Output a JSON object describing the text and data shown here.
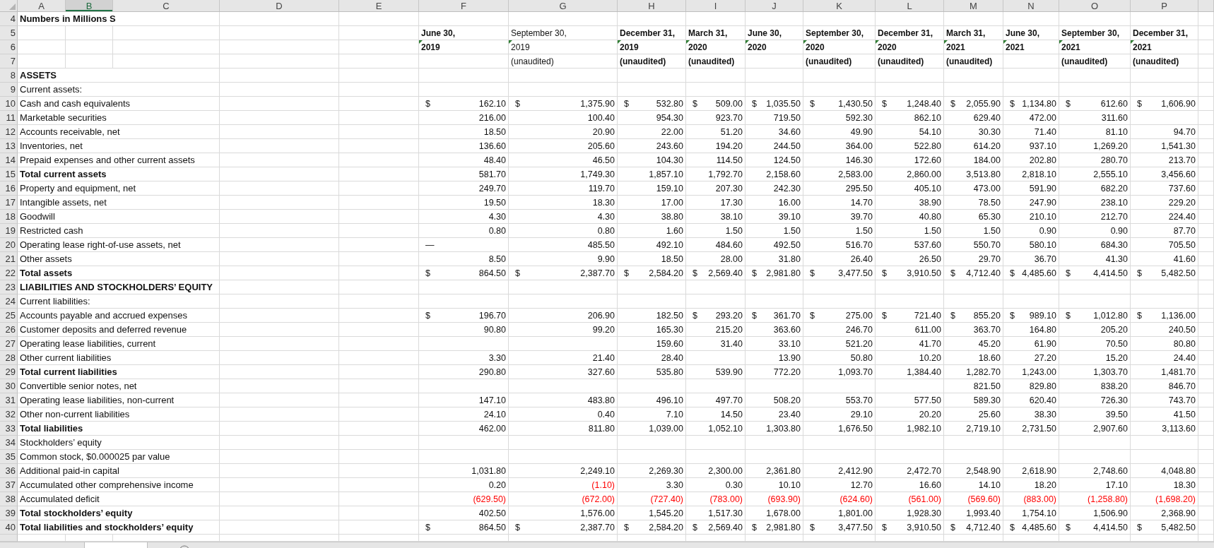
{
  "columns": [
    {
      "label": "A",
      "selected": false
    },
    {
      "label": "B",
      "selected": true
    },
    {
      "label": "C",
      "selected": false
    },
    {
      "label": "D",
      "selected": false
    },
    {
      "label": "E",
      "selected": false
    },
    {
      "label": "F",
      "selected": false
    },
    {
      "label": "G",
      "selected": false
    },
    {
      "label": "H",
      "selected": false
    },
    {
      "label": "I",
      "selected": false
    },
    {
      "label": "J",
      "selected": false
    },
    {
      "label": "K",
      "selected": false
    },
    {
      "label": "L",
      "selected": false
    },
    {
      "label": "M",
      "selected": false
    },
    {
      "label": "N",
      "selected": false
    },
    {
      "label": "O",
      "selected": false
    },
    {
      "label": "P",
      "selected": false
    }
  ],
  "title_row": {
    "number": "4",
    "text": "Numbers in Millions S"
  },
  "header_row_numbers": [
    "5",
    "6",
    "7"
  ],
  "periods": [
    {
      "date": "June 30,",
      "year": "2019",
      "bold": true
    },
    {
      "date": "September 30,",
      "year": "2019",
      "note": "(unaudited)",
      "bold": false
    },
    {
      "date": "December 31,",
      "year": "2019",
      "note": "(unaudited)",
      "bold": true
    },
    {
      "date": "March 31,",
      "year": "2020",
      "note": "(unaudited)",
      "bold": true
    },
    {
      "date": "June 30,",
      "year": "2020",
      "bold": true
    },
    {
      "date": "September 30,",
      "year": "2020",
      "note": "(unaudited)",
      "bold": true
    },
    {
      "date": "December 31,",
      "year": "2020",
      "note": "(unaudited)",
      "bold": true
    },
    {
      "date": "March 31,",
      "year": "2021",
      "note": "(unaudited)",
      "bold": true
    },
    {
      "date": "June 30,",
      "year": "2021",
      "bold": true
    },
    {
      "date": "September 30,",
      "year": "2021",
      "note": "(unaudited)",
      "bold": true
    },
    {
      "date": "December 31,",
      "year": "2021",
      "note": "(unaudited)",
      "bold": true
    }
  ],
  "rows": [
    {
      "number": "8",
      "label": "ASSETS",
      "bold": true
    },
    {
      "number": "9",
      "label": "Current assets:",
      "bold": false
    },
    {
      "number": "10",
      "label": "Cash and cash equivalents",
      "bold": false,
      "cells": [
        {
          "symbol": "$",
          "value": "162.10"
        },
        {
          "symbol": "$",
          "value": "1,375.90"
        },
        {
          "symbol": "$",
          "value": "532.80"
        },
        {
          "symbol": "$",
          "value": "509.00"
        },
        {
          "symbol": "$",
          "value": "1,035.50"
        },
        {
          "symbol": "$",
          "value": "1,430.50"
        },
        {
          "symbol": "$",
          "value": "1,248.40"
        },
        {
          "symbol": "$",
          "value": "2,055.90"
        },
        {
          "symbol": "$",
          "value": "1,134.80"
        },
        {
          "symbol": "$",
          "value": "612.60"
        },
        {
          "symbol": "$",
          "value": "1,606.90"
        }
      ]
    },
    {
      "number": "11",
      "label": "Marketable securities",
      "bold": false,
      "cells": [
        "216.00",
        "100.40",
        "954.30",
        "923.70",
        "719.50",
        "592.30",
        "862.10",
        "629.40",
        "472.00",
        "311.60",
        null
      ]
    },
    {
      "number": "12",
      "label": "Accounts receivable, net",
      "bold": false,
      "cells": [
        "18.50",
        "20.90",
        "22.00",
        "51.20",
        "34.60",
        "49.90",
        "54.10",
        "30.30",
        "71.40",
        "81.10",
        "94.70"
      ]
    },
    {
      "number": "13",
      "label": "Inventories, net",
      "bold": false,
      "cells": [
        "136.60",
        "205.60",
        "243.60",
        "194.20",
        "244.50",
        "364.00",
        "522.80",
        "614.20",
        "937.10",
        "1,269.20",
        "1,541.30"
      ]
    },
    {
      "number": "14",
      "label": "Prepaid expenses and other current assets",
      "bold": false,
      "cells": [
        "48.40",
        "46.50",
        "104.30",
        "114.50",
        "124.50",
        "146.30",
        "172.60",
        "184.00",
        "202.80",
        "280.70",
        "213.70"
      ]
    },
    {
      "number": "15",
      "label": "Total current assets",
      "bold": true,
      "cells": [
        "581.70",
        "1,749.30",
        "1,857.10",
        "1,792.70",
        "2,158.60",
        "2,583.00",
        "2,860.00",
        "3,513.80",
        "2,818.10",
        "2,555.10",
        "3,456.60"
      ]
    },
    {
      "number": "16",
      "label": "Property and equipment, net",
      "bold": false,
      "cells": [
        "249.70",
        "119.70",
        "159.10",
        "207.30",
        "242.30",
        "295.50",
        "405.10",
        "473.00",
        "591.90",
        "682.20",
        "737.60"
      ]
    },
    {
      "number": "17",
      "label": "Intangible assets, net",
      "bold": false,
      "cells": [
        "19.50",
        "18.30",
        "17.00",
        "17.30",
        "16.00",
        "14.70",
        "38.90",
        "78.50",
        "247.90",
        "238.10",
        "229.20"
      ]
    },
    {
      "number": "18",
      "label": "Goodwill",
      "bold": false,
      "cells": [
        "4.30",
        "4.30",
        "38.80",
        "38.10",
        "39.10",
        "39.70",
        "40.80",
        "65.30",
        "210.10",
        "212.70",
        "224.40"
      ]
    },
    {
      "number": "19",
      "label": "Restricted cash",
      "bold": false,
      "cells": [
        "0.80",
        "0.80",
        "1.60",
        "1.50",
        "1.50",
        "1.50",
        "1.50",
        "1.50",
        "0.90",
        "0.90",
        "87.70"
      ]
    },
    {
      "number": "20",
      "label": "Operating lease right-of-use assets, net",
      "bold": false,
      "cells": [
        {
          "symbol": "—"
        },
        "485.50",
        "492.10",
        "484.60",
        "492.50",
        "516.70",
        "537.60",
        "550.70",
        "580.10",
        "684.30",
        "705.50"
      ]
    },
    {
      "number": "21",
      "label": "Other assets",
      "bold": false,
      "cells": [
        "8.50",
        "9.90",
        "18.50",
        "28.00",
        "31.80",
        "26.40",
        "26.50",
        "29.70",
        "36.70",
        "41.30",
        "41.60"
      ]
    },
    {
      "number": "22",
      "label": "Total assets",
      "bold": true,
      "cells": [
        {
          "symbol": "$",
          "value": "864.50"
        },
        {
          "symbol": "$",
          "value": "2,387.70"
        },
        {
          "symbol": "$",
          "value": "2,584.20"
        },
        {
          "symbol": "$",
          "value": "2,569.40"
        },
        {
          "symbol": "$",
          "value": "2,981.80"
        },
        {
          "symbol": "$",
          "value": "3,477.50"
        },
        {
          "symbol": "$",
          "value": "3,910.50"
        },
        {
          "symbol": "$",
          "value": "4,712.40"
        },
        {
          "symbol": "$",
          "value": "4,485.60"
        },
        {
          "symbol": "$",
          "value": "4,414.50"
        },
        {
          "symbol": "$",
          "value": "5,482.50"
        }
      ]
    },
    {
      "number": "23",
      "label": "LIABILITIES AND STOCKHOLDERS’ EQUITY",
      "bold": true
    },
    {
      "number": "24",
      "label": "Current liabilities:",
      "bold": false
    },
    {
      "number": "25",
      "label": "Accounts payable and accrued expenses",
      "bold": false,
      "cells": [
        {
          "symbol": "$",
          "value": "196.70"
        },
        "206.90",
        "182.50",
        {
          "symbol": "$",
          "value": "293.20"
        },
        {
          "symbol": "$",
          "value": "361.70"
        },
        {
          "symbol": "$",
          "value": "275.00"
        },
        {
          "symbol": "$",
          "value": "721.40"
        },
        {
          "symbol": "$",
          "value": "855.20"
        },
        {
          "symbol": "$",
          "value": "989.10"
        },
        {
          "symbol": "$",
          "value": "1,012.80"
        },
        {
          "symbol": "$",
          "value": "1,136.00"
        }
      ]
    },
    {
      "number": "26",
      "label": "Customer deposits and deferred revenue",
      "bold": false,
      "cells": [
        "90.80",
        "99.20",
        "165.30",
        "215.20",
        "363.60",
        "246.70",
        "611.00",
        "363.70",
        "164.80",
        "205.20",
        "240.50"
      ]
    },
    {
      "number": "27",
      "label": "Operating lease liabilities, current",
      "bold": false,
      "cells": [
        null,
        null,
        "159.60",
        "31.40",
        "33.10",
        "521.20",
        "41.70",
        "45.20",
        "61.90",
        "70.50",
        "80.80"
      ]
    },
    {
      "number": "28",
      "label": "Other current liabilities",
      "bold": false,
      "cells": [
        "3.30",
        "21.40",
        "28.40",
        null,
        "13.90",
        "50.80",
        "10.20",
        "18.60",
        "27.20",
        "15.20",
        "24.40"
      ]
    },
    {
      "number": "29",
      "label": "Total current liabilities",
      "bold": true,
      "cells": [
        "290.80",
        "327.60",
        "535.80",
        "539.90",
        "772.20",
        "1,093.70",
        "1,384.40",
        "1,282.70",
        "1,243.00",
        "1,303.70",
        "1,481.70"
      ]
    },
    {
      "number": "30",
      "label": "Convertible senior notes, net",
      "bold": false,
      "cells": [
        null,
        null,
        null,
        null,
        null,
        null,
        null,
        "821.50",
        "829.80",
        "838.20",
        "846.70"
      ]
    },
    {
      "number": "31",
      "label": "Operating lease liabilities, non-current",
      "bold": false,
      "cells": [
        "147.10",
        "483.80",
        "496.10",
        "497.70",
        "508.20",
        "553.70",
        "577.50",
        "589.30",
        "620.40",
        "726.30",
        "743.70"
      ]
    },
    {
      "number": "32",
      "label": "Other non-current liabilities",
      "bold": false,
      "cells": [
        "24.10",
        "0.40",
        "7.10",
        "14.50",
        "23.40",
        "29.10",
        "20.20",
        "25.60",
        "38.30",
        "39.50",
        "41.50"
      ]
    },
    {
      "number": "33",
      "label": "Total liabilities",
      "bold": true,
      "cells": [
        "462.00",
        "811.80",
        "1,039.00",
        "1,052.10",
        "1,303.80",
        "1,676.50",
        "1,982.10",
        "2,719.10",
        "2,731.50",
        "2,907.60",
        "3,113.60"
      ]
    },
    {
      "number": "34",
      "label": "Stockholders’ equity",
      "bold": false
    },
    {
      "number": "35",
      "label": "Common stock, $0.000025 par value",
      "bold": false
    },
    {
      "number": "36",
      "label": "Additional paid-in capital",
      "bold": false,
      "cells": [
        "1,031.80",
        "2,249.10",
        "2,269.30",
        "2,300.00",
        "2,361.80",
        "2,412.90",
        "2,472.70",
        "2,548.90",
        "2,618.90",
        "2,748.60",
        "4,048.80"
      ]
    },
    {
      "number": "37",
      "label": "Accumulated other comprehensive income",
      "bold": false,
      "cells": [
        "0.20",
        {
          "value": "(1.10)",
          "negative": true
        },
        "3.30",
        "0.30",
        "10.10",
        "12.70",
        "16.60",
        "14.10",
        "18.20",
        "17.10",
        "18.30"
      ]
    },
    {
      "number": "38",
      "label": "Accumulated deficit",
      "bold": false,
      "cells": [
        {
          "value": "(629.50)",
          "negative": true
        },
        {
          "value": "(672.00)",
          "negative": true
        },
        {
          "value": "(727.40)",
          "negative": true
        },
        {
          "value": "(783.00)",
          "negative": true
        },
        {
          "value": "(693.90)",
          "negative": true
        },
        {
          "value": "(624.60)",
          "negative": true
        },
        {
          "value": "(561.00)",
          "negative": true
        },
        {
          "value": "(569.60)",
          "negative": true
        },
        {
          "value": "(883.00)",
          "negative": true
        },
        {
          "value": "(1,258.80)",
          "negative": true
        },
        {
          "value": "(1,698.20)",
          "negative": true
        }
      ]
    },
    {
      "number": "39",
      "label": "Total stockholders’ equity",
      "bold": true,
      "cells": [
        "402.50",
        "1,576.00",
        "1,545.20",
        "1,517.30",
        "1,678.00",
        "1,801.00",
        "1,928.30",
        "1,993.40",
        "1,754.10",
        "1,506.90",
        "2,368.90"
      ]
    },
    {
      "number": "40",
      "label": "Total liabilities and stockholders’ equity",
      "bold": true,
      "cells": [
        {
          "symbol": "$",
          "value": "864.50"
        },
        {
          "symbol": "$",
          "value": "2,387.70"
        },
        {
          "symbol": "$",
          "value": "2,584.20"
        },
        {
          "symbol": "$",
          "value": "2,569.40"
        },
        {
          "symbol": "$",
          "value": "2,981.80"
        },
        {
          "symbol": "$",
          "value": "3,477.50"
        },
        {
          "symbol": "$",
          "value": "3,910.50"
        },
        {
          "symbol": "$",
          "value": "4,712.40"
        },
        {
          "symbol": "$",
          "value": "4,485.60"
        },
        {
          "symbol": "$",
          "value": "4,414.50"
        },
        {
          "symbol": "$",
          "value": "5,482.50"
        }
      ]
    }
  ]
}
